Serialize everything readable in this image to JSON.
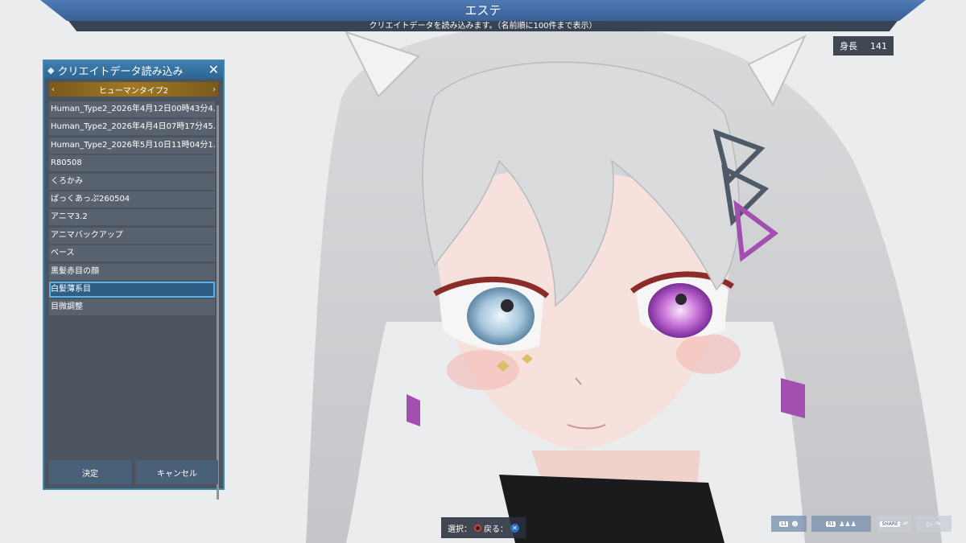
{
  "header": {
    "title": "エステ",
    "subtitle": "クリエイトデータを読み込みます。（名前順に100件まで表示）"
  },
  "stat": {
    "label": "身長",
    "value": "141"
  },
  "panel": {
    "title": "クリエイトデータ読み込み",
    "close_symbol": "✕",
    "type_selector": {
      "label": "ヒューマンタイプ2",
      "prev": "‹",
      "next": "›"
    },
    "items": [
      {
        "label": "Human_Type2_2026年4月12日00時43分4..."
      },
      {
        "label": "Human_Type2_2026年4月4日07時17分45..."
      },
      {
        "label": "Human_Type2_2026年5月10日11時04分1..."
      },
      {
        "label": "R80508"
      },
      {
        "label": "くろかみ"
      },
      {
        "label": "ばっくあっぷ260504"
      },
      {
        "label": "アニマ3.2"
      },
      {
        "label": "アニマバックアップ"
      },
      {
        "label": "ベース"
      },
      {
        "label": "黒髪赤目の顔"
      },
      {
        "label": "白髪薄系目"
      },
      {
        "label": "目微調整"
      }
    ],
    "selected_index": 10,
    "confirm_label": "決定",
    "cancel_label": "キャンセル"
  },
  "prompt": {
    "select_label": "選択：",
    "back_label": "戻る："
  },
  "toolbar": {
    "l1": "L1",
    "r1": "R1",
    "share": "SHARE"
  },
  "colors": {
    "accent": "#3d87b5",
    "panel_bg": "#3f4854",
    "selected_bg": "#2d5e86",
    "banner": "#4e79b3"
  }
}
